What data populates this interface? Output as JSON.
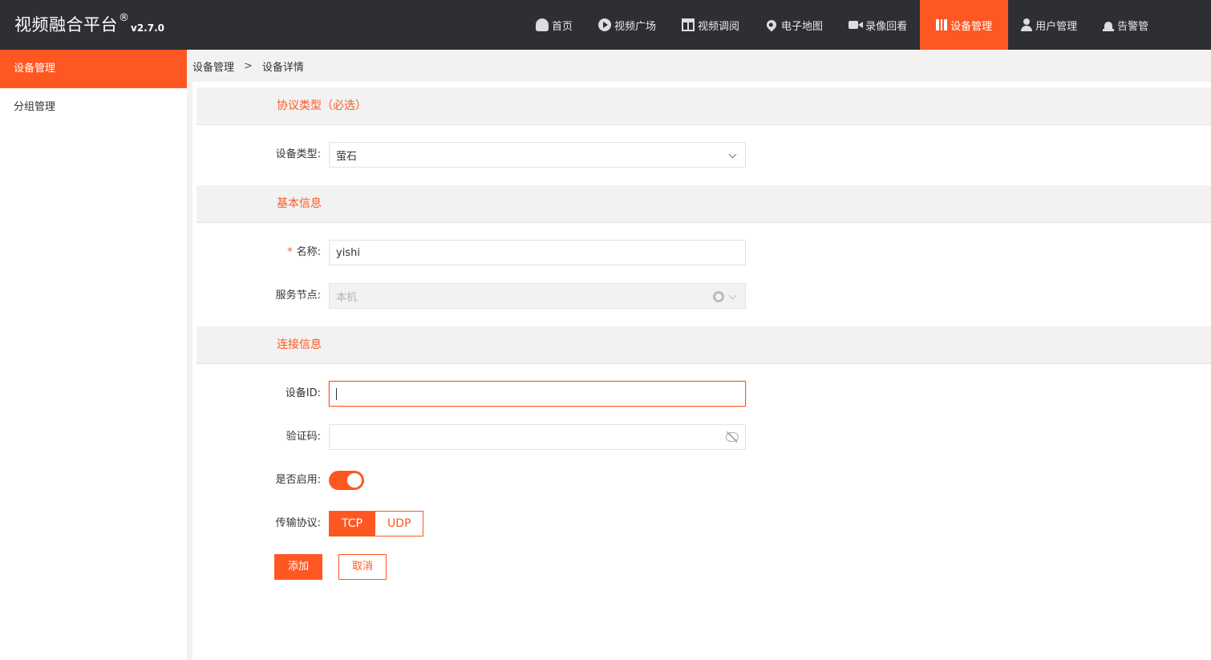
{
  "app": {
    "title": "视频融合平台",
    "reg": "®",
    "version": "v2.7.0"
  },
  "nav": [
    {
      "label": "首页",
      "icon": "dashboard-icon"
    },
    {
      "label": "视频广场",
      "icon": "play-icon"
    },
    {
      "label": "视频调阅",
      "icon": "grid-icon"
    },
    {
      "label": "电子地图",
      "icon": "map-pin-icon"
    },
    {
      "label": "录像回看",
      "icon": "video-camera-icon"
    },
    {
      "label": "设备管理",
      "icon": "book-icon",
      "active": true
    },
    {
      "label": "用户管理",
      "icon": "user-icon"
    },
    {
      "label": "告警管",
      "icon": "alarm-icon"
    }
  ],
  "sidebar": {
    "items": [
      {
        "label": "设备管理",
        "active": true
      },
      {
        "label": "分组管理"
      }
    ]
  },
  "breadcrumb": {
    "items": [
      "设备管理",
      "设备详情"
    ],
    "separator": ">"
  },
  "form": {
    "sections": {
      "protocol": "协议类型（必选）",
      "basic": "基本信息",
      "connection": "连接信息"
    },
    "device_type": {
      "label": "设备类型:",
      "value": "萤石"
    },
    "name": {
      "required": "*",
      "label": "名称:",
      "value": "yishi"
    },
    "service_node": {
      "label": "服务节点:",
      "value": "本机"
    },
    "device_id": {
      "label": "设备ID:",
      "value": ""
    },
    "verify_code": {
      "label": "验证码:",
      "value": ""
    },
    "enabled": {
      "label": "是否启用:",
      "value": true
    },
    "transport": {
      "label": "传输协议:",
      "options": [
        "TCP",
        "UDP"
      ],
      "selected": "TCP"
    },
    "buttons": {
      "add": "添加",
      "cancel": "取消"
    }
  },
  "colors": {
    "accent": "#ff5722",
    "topbar": "#2d2f33",
    "section_bg": "#f2f2f2"
  }
}
